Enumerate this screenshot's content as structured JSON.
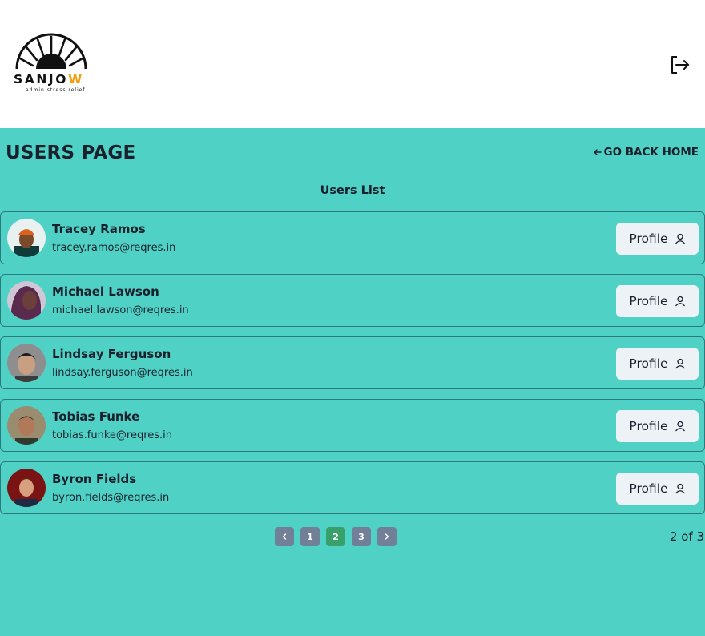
{
  "header": {
    "logo_word": "SANJO",
    "logo_word_accent": "W",
    "logo_tagline": "admin stress relief",
    "logout_icon": "logout-icon"
  },
  "page": {
    "title": "USERS PAGE",
    "back_link": "GO BACK HOME",
    "list_title": "Users List"
  },
  "users": [
    {
      "name": "Tracey Ramos",
      "email": "tracey.ramos@reqres.in",
      "profile_label": "Profile"
    },
    {
      "name": "Michael Lawson",
      "email": "michael.lawson@reqres.in",
      "profile_label": "Profile"
    },
    {
      "name": "Lindsay Ferguson",
      "email": "lindsay.ferguson@reqres.in",
      "profile_label": "Profile"
    },
    {
      "name": "Tobias Funke",
      "email": "tobias.funke@reqres.in",
      "profile_label": "Profile"
    },
    {
      "name": "Byron Fields",
      "email": "byron.fields@reqres.in",
      "profile_label": "Profile"
    }
  ],
  "pagination": {
    "pages": [
      "1",
      "2",
      "3"
    ],
    "current": "2",
    "summary": "2 of 3"
  },
  "colors": {
    "page_bg": "#4fd1c5",
    "header_bg": "#ffffff",
    "active_page": "#38a169",
    "inactive_page": "#718096",
    "profile_button": "#edf2f7",
    "logo_accent": "#f59e0b"
  }
}
